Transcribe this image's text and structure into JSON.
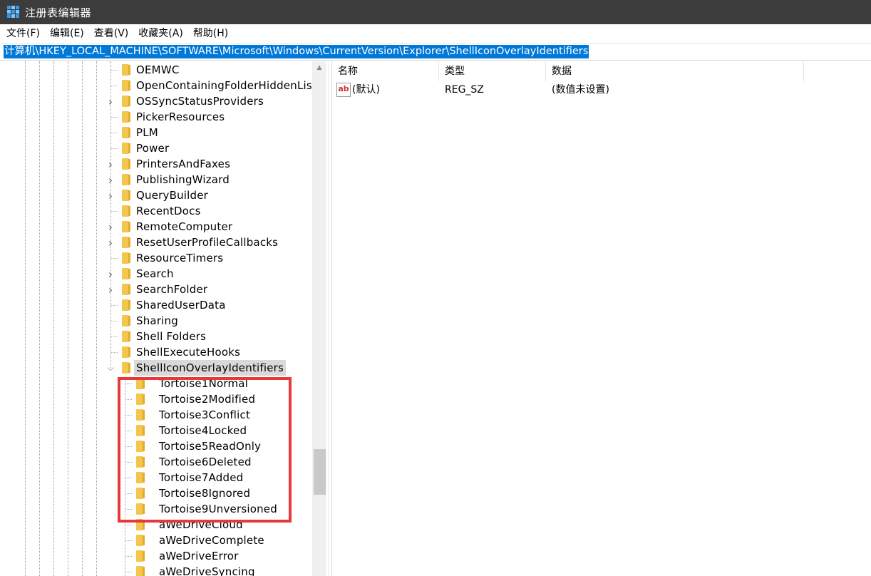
{
  "window": {
    "title": "注册表编辑器"
  },
  "menu": [
    "文件(F)",
    "编辑(E)",
    "查看(V)",
    "收藏夹(A)",
    "帮助(H)"
  ],
  "address": "计算机\\HKEY_LOCAL_MACHINE\\SOFTWARE\\Microsoft\\Windows\\CurrentVersion\\Explorer\\ShellIconOverlayIdentifiers",
  "tree": {
    "items": [
      {
        "label": "OEMWC",
        "expandable": false
      },
      {
        "label": "OpenContainingFolderHiddenList",
        "expandable": false
      },
      {
        "label": "OSSyncStatusProviders",
        "expandable": true
      },
      {
        "label": "PickerResources",
        "expandable": false
      },
      {
        "label": "PLM",
        "expandable": false
      },
      {
        "label": "Power",
        "expandable": false
      },
      {
        "label": "PrintersAndFaxes",
        "expandable": true
      },
      {
        "label": "PublishingWizard",
        "expandable": true
      },
      {
        "label": "QueryBuilder",
        "expandable": true
      },
      {
        "label": "RecentDocs",
        "expandable": false
      },
      {
        "label": "RemoteComputer",
        "expandable": true
      },
      {
        "label": "ResetUserProfileCallbacks",
        "expandable": true
      },
      {
        "label": "ResourceTimers",
        "expandable": false
      },
      {
        "label": "Search",
        "expandable": true
      },
      {
        "label": "SearchFolder",
        "expandable": true
      },
      {
        "label": "SharedUserData",
        "expandable": false
      },
      {
        "label": "Sharing",
        "expandable": false
      },
      {
        "label": "Shell Folders",
        "expandable": false
      },
      {
        "label": "ShellExecuteHooks",
        "expandable": false
      },
      {
        "label": "ShellIconOverlayIdentifiers",
        "expandable": true,
        "expanded": true,
        "selected": true
      }
    ],
    "overlay_children": [
      " Tortoise1Normal",
      " Tortoise2Modified",
      " Tortoise3Conflict",
      " Tortoise4Locked",
      " Tortoise5ReadOnly",
      " Tortoise6Deleted",
      " Tortoise7Added",
      " Tortoise8Ignored",
      " Tortoise9Unversioned",
      "aWeDriveCloud",
      "aWeDriveComplete",
      "aWeDriveError",
      "aWeDriveSyncing"
    ]
  },
  "list": {
    "columns": [
      "名称",
      "类型",
      "数据"
    ],
    "rows": [
      {
        "icon": "ab",
        "name": "(默认)",
        "type": "REG_SZ",
        "data": "(数值未设置)"
      }
    ]
  },
  "colors": {
    "highlight_box": "#e8383b",
    "address_selection": "#0078d7",
    "folder": "#f3c64d"
  }
}
